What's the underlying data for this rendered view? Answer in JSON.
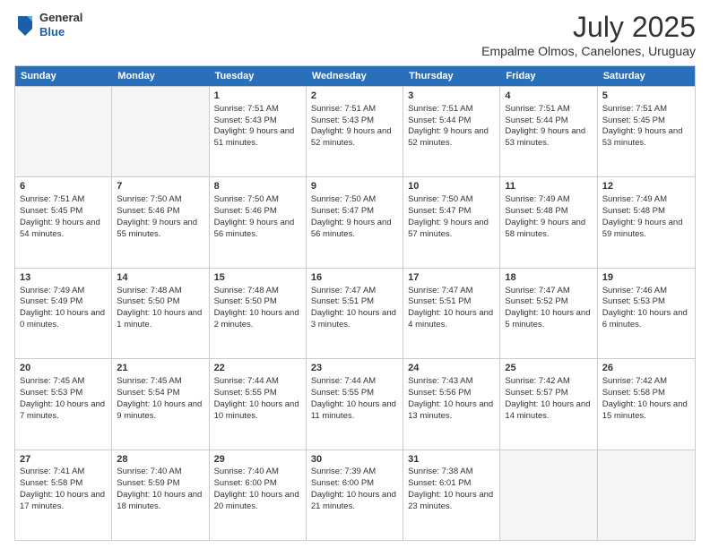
{
  "logo": {
    "general": "General",
    "blue": "Blue"
  },
  "header": {
    "title": "July 2025",
    "subtitle": "Empalme Olmos, Canelones, Uruguay"
  },
  "weekdays": [
    "Sunday",
    "Monday",
    "Tuesday",
    "Wednesday",
    "Thursday",
    "Friday",
    "Saturday"
  ],
  "rows": [
    [
      {
        "day": "",
        "sunrise": "",
        "sunset": "",
        "daylight": "",
        "empty": true
      },
      {
        "day": "",
        "sunrise": "",
        "sunset": "",
        "daylight": "",
        "empty": true
      },
      {
        "day": "1",
        "sunrise": "Sunrise: 7:51 AM",
        "sunset": "Sunset: 5:43 PM",
        "daylight": "Daylight: 9 hours and 51 minutes."
      },
      {
        "day": "2",
        "sunrise": "Sunrise: 7:51 AM",
        "sunset": "Sunset: 5:43 PM",
        "daylight": "Daylight: 9 hours and 52 minutes."
      },
      {
        "day": "3",
        "sunrise": "Sunrise: 7:51 AM",
        "sunset": "Sunset: 5:44 PM",
        "daylight": "Daylight: 9 hours and 52 minutes."
      },
      {
        "day": "4",
        "sunrise": "Sunrise: 7:51 AM",
        "sunset": "Sunset: 5:44 PM",
        "daylight": "Daylight: 9 hours and 53 minutes."
      },
      {
        "day": "5",
        "sunrise": "Sunrise: 7:51 AM",
        "sunset": "Sunset: 5:45 PM",
        "daylight": "Daylight: 9 hours and 53 minutes."
      }
    ],
    [
      {
        "day": "6",
        "sunrise": "Sunrise: 7:51 AM",
        "sunset": "Sunset: 5:45 PM",
        "daylight": "Daylight: 9 hours and 54 minutes."
      },
      {
        "day": "7",
        "sunrise": "Sunrise: 7:50 AM",
        "sunset": "Sunset: 5:46 PM",
        "daylight": "Daylight: 9 hours and 55 minutes."
      },
      {
        "day": "8",
        "sunrise": "Sunrise: 7:50 AM",
        "sunset": "Sunset: 5:46 PM",
        "daylight": "Daylight: 9 hours and 56 minutes."
      },
      {
        "day": "9",
        "sunrise": "Sunrise: 7:50 AM",
        "sunset": "Sunset: 5:47 PM",
        "daylight": "Daylight: 9 hours and 56 minutes."
      },
      {
        "day": "10",
        "sunrise": "Sunrise: 7:50 AM",
        "sunset": "Sunset: 5:47 PM",
        "daylight": "Daylight: 9 hours and 57 minutes."
      },
      {
        "day": "11",
        "sunrise": "Sunrise: 7:49 AM",
        "sunset": "Sunset: 5:48 PM",
        "daylight": "Daylight: 9 hours and 58 minutes."
      },
      {
        "day": "12",
        "sunrise": "Sunrise: 7:49 AM",
        "sunset": "Sunset: 5:48 PM",
        "daylight": "Daylight: 9 hours and 59 minutes."
      }
    ],
    [
      {
        "day": "13",
        "sunrise": "Sunrise: 7:49 AM",
        "sunset": "Sunset: 5:49 PM",
        "daylight": "Daylight: 10 hours and 0 minutes."
      },
      {
        "day": "14",
        "sunrise": "Sunrise: 7:48 AM",
        "sunset": "Sunset: 5:50 PM",
        "daylight": "Daylight: 10 hours and 1 minute."
      },
      {
        "day": "15",
        "sunrise": "Sunrise: 7:48 AM",
        "sunset": "Sunset: 5:50 PM",
        "daylight": "Daylight: 10 hours and 2 minutes."
      },
      {
        "day": "16",
        "sunrise": "Sunrise: 7:47 AM",
        "sunset": "Sunset: 5:51 PM",
        "daylight": "Daylight: 10 hours and 3 minutes."
      },
      {
        "day": "17",
        "sunrise": "Sunrise: 7:47 AM",
        "sunset": "Sunset: 5:51 PM",
        "daylight": "Daylight: 10 hours and 4 minutes."
      },
      {
        "day": "18",
        "sunrise": "Sunrise: 7:47 AM",
        "sunset": "Sunset: 5:52 PM",
        "daylight": "Daylight: 10 hours and 5 minutes."
      },
      {
        "day": "19",
        "sunrise": "Sunrise: 7:46 AM",
        "sunset": "Sunset: 5:53 PM",
        "daylight": "Daylight: 10 hours and 6 minutes."
      }
    ],
    [
      {
        "day": "20",
        "sunrise": "Sunrise: 7:45 AM",
        "sunset": "Sunset: 5:53 PM",
        "daylight": "Daylight: 10 hours and 7 minutes."
      },
      {
        "day": "21",
        "sunrise": "Sunrise: 7:45 AM",
        "sunset": "Sunset: 5:54 PM",
        "daylight": "Daylight: 10 hours and 9 minutes."
      },
      {
        "day": "22",
        "sunrise": "Sunrise: 7:44 AM",
        "sunset": "Sunset: 5:55 PM",
        "daylight": "Daylight: 10 hours and 10 minutes."
      },
      {
        "day": "23",
        "sunrise": "Sunrise: 7:44 AM",
        "sunset": "Sunset: 5:55 PM",
        "daylight": "Daylight: 10 hours and 11 minutes."
      },
      {
        "day": "24",
        "sunrise": "Sunrise: 7:43 AM",
        "sunset": "Sunset: 5:56 PM",
        "daylight": "Daylight: 10 hours and 13 minutes."
      },
      {
        "day": "25",
        "sunrise": "Sunrise: 7:42 AM",
        "sunset": "Sunset: 5:57 PM",
        "daylight": "Daylight: 10 hours and 14 minutes."
      },
      {
        "day": "26",
        "sunrise": "Sunrise: 7:42 AM",
        "sunset": "Sunset: 5:58 PM",
        "daylight": "Daylight: 10 hours and 15 minutes."
      }
    ],
    [
      {
        "day": "27",
        "sunrise": "Sunrise: 7:41 AM",
        "sunset": "Sunset: 5:58 PM",
        "daylight": "Daylight: 10 hours and 17 minutes."
      },
      {
        "day": "28",
        "sunrise": "Sunrise: 7:40 AM",
        "sunset": "Sunset: 5:59 PM",
        "daylight": "Daylight: 10 hours and 18 minutes."
      },
      {
        "day": "29",
        "sunrise": "Sunrise: 7:40 AM",
        "sunset": "Sunset: 6:00 PM",
        "daylight": "Daylight: 10 hours and 20 minutes."
      },
      {
        "day": "30",
        "sunrise": "Sunrise: 7:39 AM",
        "sunset": "Sunset: 6:00 PM",
        "daylight": "Daylight: 10 hours and 21 minutes."
      },
      {
        "day": "31",
        "sunrise": "Sunrise: 7:38 AM",
        "sunset": "Sunset: 6:01 PM",
        "daylight": "Daylight: 10 hours and 23 minutes."
      },
      {
        "day": "",
        "sunrise": "",
        "sunset": "",
        "daylight": "",
        "empty": true
      },
      {
        "day": "",
        "sunrise": "",
        "sunset": "",
        "daylight": "",
        "empty": true
      }
    ]
  ]
}
